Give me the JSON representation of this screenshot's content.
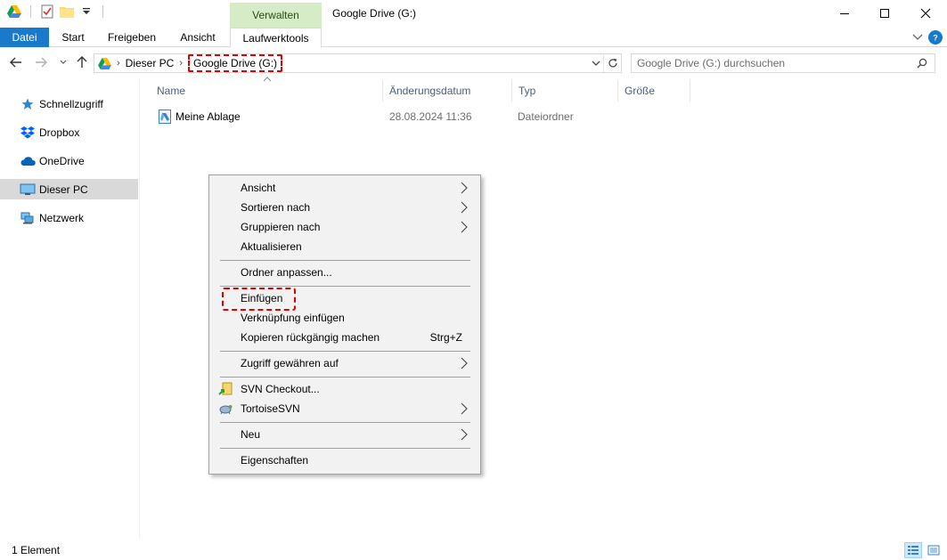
{
  "window": {
    "title": "Google Drive (G:)",
    "context_tab_group": "Verwalten"
  },
  "ribbon": {
    "tabs": [
      "Datei",
      "Start",
      "Freigeben",
      "Ansicht",
      "Laufwerktools"
    ],
    "active_tab": "Laufwerktools"
  },
  "address": {
    "crumbs": [
      "Dieser PC",
      "Google Drive (G:)"
    ]
  },
  "search": {
    "placeholder": "Google Drive (G:) durchsuchen"
  },
  "navpane": {
    "items": [
      {
        "label": "Schnellzugriff",
        "icon": "star-icon"
      },
      {
        "label": "Dropbox",
        "icon": "dropbox-icon"
      },
      {
        "label": "OneDrive",
        "icon": "cloud-icon"
      },
      {
        "label": "Dieser PC",
        "icon": "computer-icon",
        "selected": true
      },
      {
        "label": "Netzwerk",
        "icon": "network-icon"
      }
    ]
  },
  "columns": [
    "Name",
    "Änderungsdatum",
    "Typ",
    "Größe"
  ],
  "files": [
    {
      "name": "Meine Ablage",
      "date": "28.08.2024 11:36",
      "type": "Dateiordner",
      "size": ""
    }
  ],
  "context_menu": {
    "items": [
      {
        "label": "Ansicht",
        "submenu": true
      },
      {
        "label": "Sortieren nach",
        "submenu": true
      },
      {
        "label": "Gruppieren nach",
        "submenu": true
      },
      {
        "label": "Aktualisieren"
      },
      {
        "label": "Ordner anpassen..."
      },
      {
        "label": "Einfügen",
        "highlighted": true
      },
      {
        "label": "Verknüpfung einfügen"
      },
      {
        "label": "Kopieren rückgängig machen",
        "shortcut": "Strg+Z"
      },
      {
        "label": "Zugriff gewähren auf",
        "submenu": true
      },
      {
        "label": "SVN Checkout...",
        "icon": "svn-checkout-icon"
      },
      {
        "label": "TortoiseSVN",
        "icon": "tortoisesvn-icon",
        "submenu": true
      },
      {
        "label": "Neu",
        "submenu": true
      },
      {
        "label": "Eigenschaften"
      }
    ]
  },
  "status": {
    "count": "1 Element"
  },
  "colors": {
    "file_tab": "#1979ca",
    "context_tab": "#d6ecc6",
    "highlight": "#e00000",
    "selected_nav": "#d9d9d9",
    "menu_bg": "#f2f2f2"
  }
}
